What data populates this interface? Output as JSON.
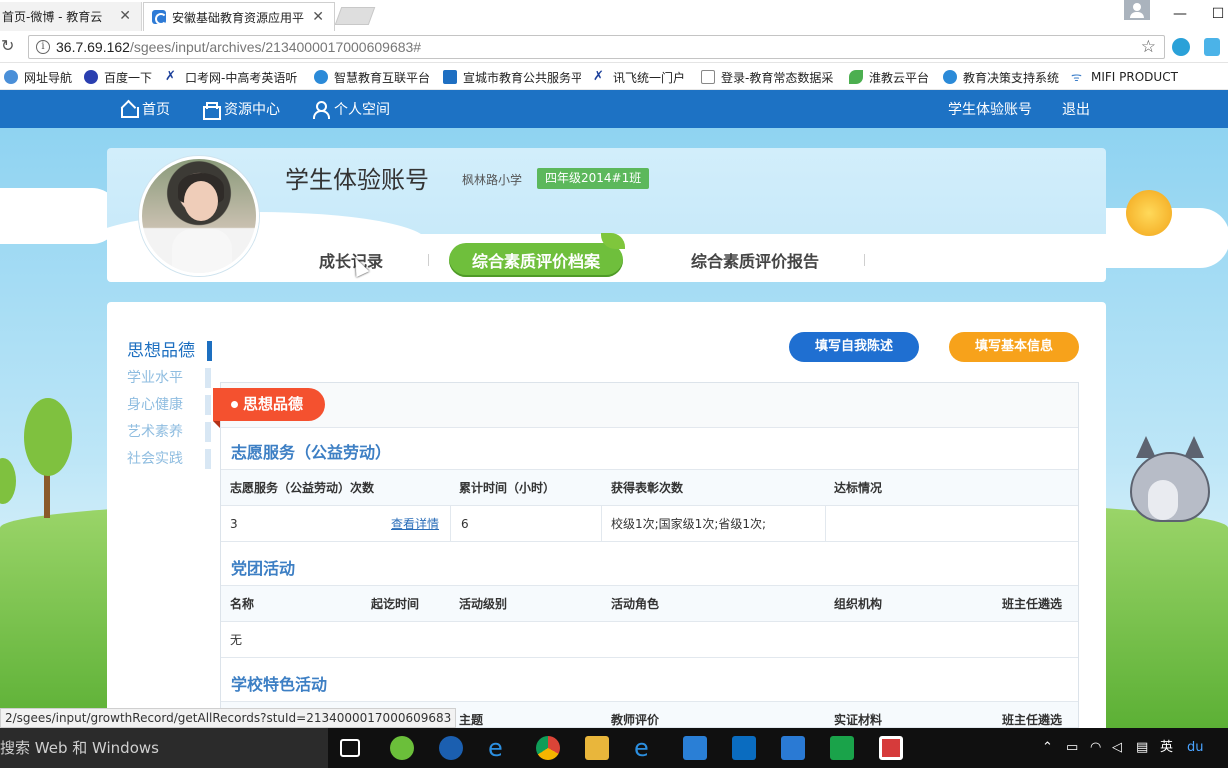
{
  "browser": {
    "tabs": [
      {
        "title": "首页-微博 - 教育云",
        "active": false
      },
      {
        "title": "安徽基础教育资源应用平",
        "active": true
      }
    ],
    "url_host": "36.7.69.162",
    "url_path": "/sgees/input/archives/2134000017000609683#",
    "bookmarks": [
      {
        "label": "网址导航",
        "icon": "globe-icon",
        "color": "#4a8fd8"
      },
      {
        "label": "百度一下",
        "icon": "paw-icon",
        "color": "#2a3fb0"
      },
      {
        "label": "口考网-中高考英语听",
        "icon": "x-icon",
        "color": "#1b3f9a"
      },
      {
        "label": "智慧教育互联平台",
        "icon": "blue-dot-icon",
        "color": "#2b8ad8"
      },
      {
        "label": "宣城市教育公共服务平",
        "icon": "c-logo-icon",
        "color": "#1e6fc2"
      },
      {
        "label": "讯飞统一门户",
        "icon": "x-icon",
        "color": "#1b3f9a"
      },
      {
        "label": "登录-教育常态数据采",
        "icon": "page-icon",
        "color": "#888888"
      },
      {
        "label": "淮教云平台",
        "icon": "leaf-icon",
        "color": "#4caf50"
      },
      {
        "label": "教育决策支持系统",
        "icon": "blue-dot-icon",
        "color": "#2b8ad8"
      },
      {
        "label": "MIFI PRODUCT",
        "icon": "wifi-icon",
        "color": "#3a7dc9"
      }
    ]
  },
  "nav": {
    "home": "首页",
    "resources": "资源中心",
    "personal": "个人空间",
    "account": "学生体验账号",
    "logout": "退出"
  },
  "profile": {
    "name": "学生体验账号",
    "school": "枫林路小学",
    "class": "四年级2014#1班",
    "tabs": [
      "成长记录",
      "综合素质评价档案",
      "综合素质评价报告"
    ],
    "active_tab": "综合素质评价档案"
  },
  "sidebar": {
    "items": [
      {
        "label": "思想品德",
        "active": true
      },
      {
        "label": "学业水平",
        "active": false
      },
      {
        "label": "身心健康",
        "active": false
      },
      {
        "label": "艺术素养",
        "active": false
      },
      {
        "label": "社会实践",
        "active": false
      }
    ]
  },
  "actions": {
    "self_statement": "填写自我陈述",
    "basic_info": "填写基本信息"
  },
  "content": {
    "ribbon": "思想品德",
    "volunteer": {
      "title": "志愿服务（公益劳动）",
      "headers": [
        "志愿服务（公益劳动）次数",
        "累计时间（小时）",
        "获得表彰次数",
        "达标情况"
      ],
      "row": {
        "count": "3",
        "detail_link": "查看详情",
        "hours": "6",
        "awards": "校级1次;国家级1次;省级1次;",
        "status": ""
      }
    },
    "party": {
      "title": "党团活动",
      "headers": [
        "名称",
        "起讫时间",
        "活动级别",
        "活动角色",
        "组织机构",
        "班主任遴选"
      ],
      "empty": "无"
    },
    "school_activity": {
      "title": "学校特色活动",
      "headers": [
        "主题",
        "教师评价",
        "实证材料",
        "班主任遴选"
      ]
    }
  },
  "status_url": "2/sgees/input/growthRecord/getAllRecords?stuId=2134000017000609683",
  "taskbar": {
    "search": "搜索 Web 和 Windows",
    "ime": "英",
    "baidu": "du"
  }
}
